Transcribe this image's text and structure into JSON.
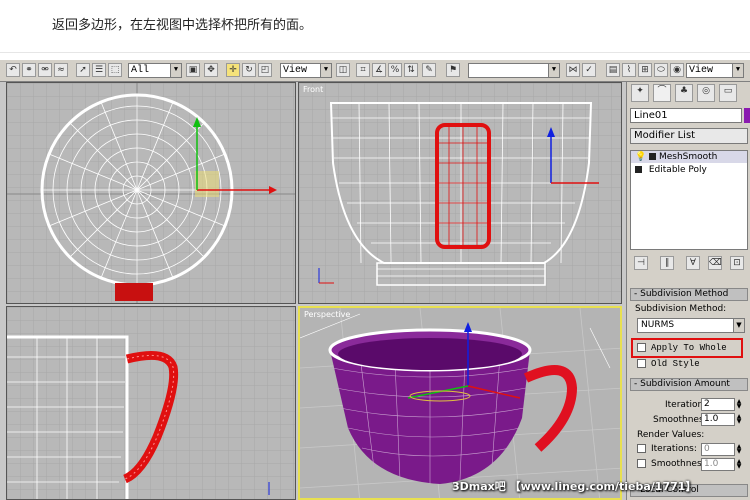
{
  "caption": "返回多边形，在左视图中选择杯把所有的面。",
  "toolbar": {
    "selection_filter": "All",
    "ref_coord": "View",
    "ref_coord_right": "View",
    "named_selection": ""
  },
  "viewports": {
    "top_left_label": "",
    "top_right_label": "Front",
    "bottom_left_label": "",
    "bottom_right_label": "Perspective"
  },
  "panel": {
    "object_name": "Line01",
    "modifier_list": "Modifier List",
    "stack": [
      "MeshSmooth",
      "Editable Poly"
    ],
    "subdivision_method_title": "Subdivision Method",
    "subdivision_method_label": "Subdivision Method:",
    "subdivision_method_value": "NURMS",
    "apply_to_whole": "Apply To Whole",
    "old_style": "Old Style",
    "subdivision_amount_title": "Subdivision Amount",
    "iterations_label": "Iterations:",
    "iterations_value": "2",
    "smoothness_label": "Smoothness:",
    "smoothness_value": "1.0",
    "render_values_label": "Render Values:",
    "render_iterations_label": "Iterations:",
    "render_iterations_value": "0",
    "render_smoothness_label": "Smoothness:",
    "render_smoothness_value": "1.0",
    "local_control_title": "Local Control"
  },
  "watermark": "3Dmax吧 【www.lineg.com/tieba/1771】",
  "colors": {
    "highlight_box": "#e01010",
    "mesh_white": "#ffffff",
    "handle_red": "#d01010",
    "cup_purple": "#7a1a8a",
    "active_viewport": "#e8e050"
  }
}
